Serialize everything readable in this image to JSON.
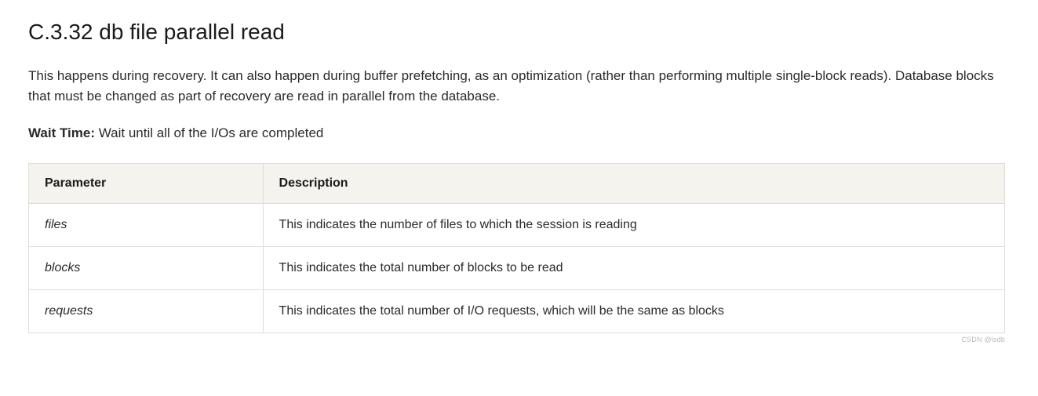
{
  "heading": "C.3.32 db file parallel read",
  "description": "This happens during recovery. It can also happen during buffer prefetching, as an optimization (rather than performing multiple single-block reads). Database blocks that must be changed as part of recovery are read in parallel from the database.",
  "waitTime": {
    "label": "Wait Time:",
    "text": " Wait until all of the I/Os are completed"
  },
  "table": {
    "headers": {
      "param": "Parameter",
      "desc": "Description"
    },
    "rows": [
      {
        "param": "files",
        "desc": "This indicates the number of files to which the session is reading"
      },
      {
        "param": "blocks",
        "desc": "This indicates the total number of blocks to be read"
      },
      {
        "param": "requests",
        "desc": "This indicates the total number of I/O requests, which will be the same as blocks"
      }
    ]
  },
  "watermark": "CSDN @lsdb"
}
